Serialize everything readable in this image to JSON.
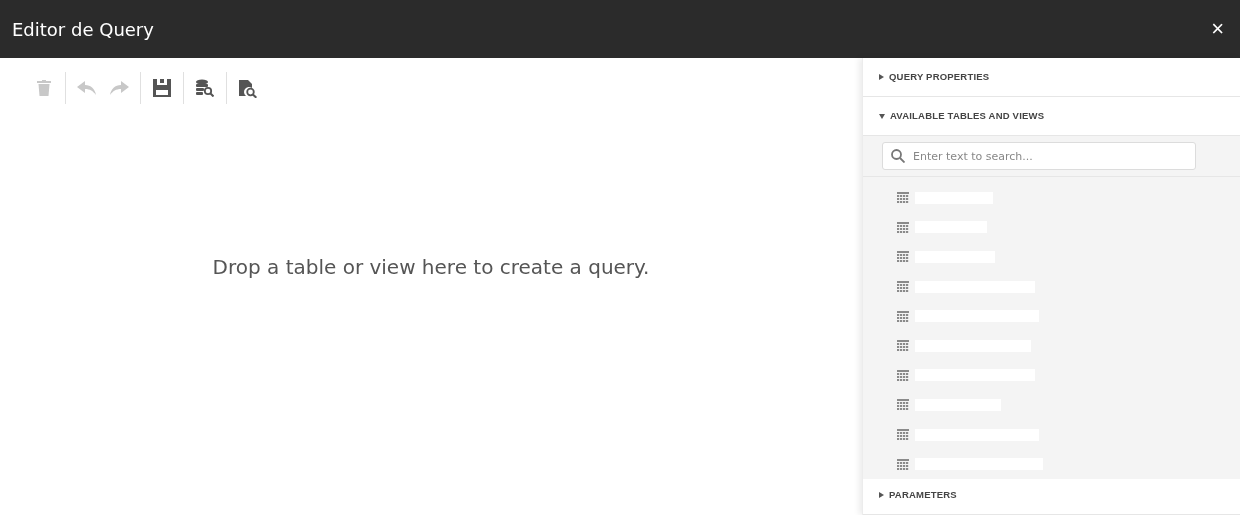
{
  "window": {
    "title": "Editor de Query",
    "close": "×"
  },
  "toolbar": [
    {
      "kind": "delete",
      "disabled": true
    },
    {
      "kind": "undo",
      "disabled": true
    },
    {
      "kind": "redo",
      "disabled": true
    },
    {
      "kind": "save",
      "disabled": false
    },
    {
      "kind": "data-source",
      "disabled": false
    },
    {
      "kind": "preview",
      "disabled": false
    }
  ],
  "canvas": {
    "hint": "Drop a table or view here to create a query."
  },
  "panel": {
    "sections": [
      {
        "title": "QUERY PROPERTIES",
        "expanded": false
      },
      {
        "title": "AVAILABLE TABLES AND VIEWS",
        "expanded": true,
        "search": {
          "placeholder": "Enter text to search..."
        },
        "tables": [
          {
            "kind": "redacted"
          },
          {
            "kind": "redacted"
          },
          {
            "kind": "redacted"
          },
          {
            "kind": "redacted"
          },
          {
            "kind": "redacted"
          },
          {
            "kind": "redacted"
          },
          {
            "kind": "redacted"
          },
          {
            "kind": "redacted"
          },
          {
            "kind": "redacted"
          },
          {
            "kind": "redacted"
          }
        ]
      },
      {
        "title": "PARAMETERS",
        "expanded": false
      }
    ]
  }
}
